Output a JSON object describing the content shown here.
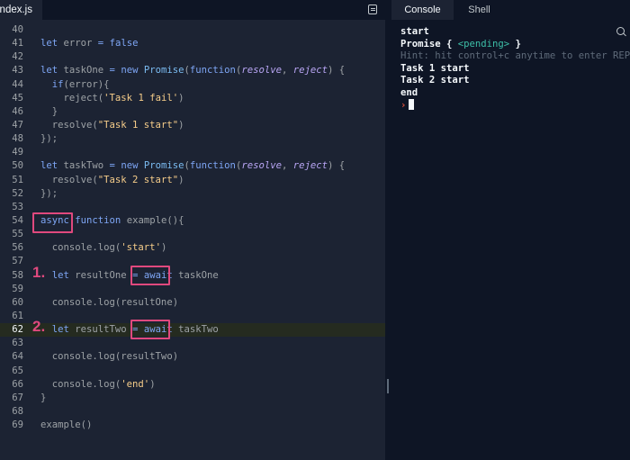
{
  "editor": {
    "file_tab": "index.js",
    "lines": [
      {
        "n": "40",
        "tokens": []
      },
      {
        "n": "41",
        "tokens": [
          [
            "k",
            "let"
          ],
          [
            "p",
            " error "
          ],
          [
            "k",
            "="
          ],
          [
            "p",
            " "
          ],
          [
            "k",
            "false"
          ]
        ]
      },
      {
        "n": "42",
        "tokens": []
      },
      {
        "n": "43",
        "tokens": [
          [
            "k",
            "let"
          ],
          [
            "p",
            " taskOne "
          ],
          [
            "k",
            "="
          ],
          [
            "p",
            " "
          ],
          [
            "k",
            "new"
          ],
          [
            "p",
            " "
          ],
          [
            "c",
            "Promise"
          ],
          [
            "p",
            "("
          ],
          [
            "k",
            "function"
          ],
          [
            "p",
            "("
          ],
          [
            "i",
            "resolve"
          ],
          [
            "p",
            ", "
          ],
          [
            "i",
            "reject"
          ],
          [
            "p",
            ") {"
          ]
        ]
      },
      {
        "n": "44",
        "tokens": [
          [
            "p",
            "  "
          ],
          [
            "k",
            "if"
          ],
          [
            "p",
            "(error){"
          ]
        ]
      },
      {
        "n": "45",
        "tokens": [
          [
            "p",
            "    reject("
          ],
          [
            "s",
            "'Task 1 fail'"
          ],
          [
            "p",
            ")"
          ]
        ]
      },
      {
        "n": "46",
        "tokens": [
          [
            "p",
            "  }"
          ]
        ]
      },
      {
        "n": "47",
        "tokens": [
          [
            "p",
            "  resolve("
          ],
          [
            "s",
            "\"Task 1 start\""
          ],
          [
            "p",
            ")"
          ]
        ]
      },
      {
        "n": "48",
        "tokens": [
          [
            "p",
            "});"
          ]
        ]
      },
      {
        "n": "49",
        "tokens": []
      },
      {
        "n": "50",
        "tokens": [
          [
            "k",
            "let"
          ],
          [
            "p",
            " taskTwo "
          ],
          [
            "k",
            "="
          ],
          [
            "p",
            " "
          ],
          [
            "k",
            "new"
          ],
          [
            "p",
            " "
          ],
          [
            "c",
            "Promise"
          ],
          [
            "p",
            "("
          ],
          [
            "k",
            "function"
          ],
          [
            "p",
            "("
          ],
          [
            "i",
            "resolve"
          ],
          [
            "p",
            ", "
          ],
          [
            "i",
            "reject"
          ],
          [
            "p",
            ") {"
          ]
        ]
      },
      {
        "n": "51",
        "tokens": [
          [
            "p",
            "  resolve("
          ],
          [
            "s",
            "\"Task 2 start\""
          ],
          [
            "p",
            ")"
          ]
        ]
      },
      {
        "n": "52",
        "tokens": [
          [
            "p",
            "});"
          ]
        ]
      },
      {
        "n": "53",
        "tokens": []
      },
      {
        "n": "54",
        "tokens": [
          [
            "k",
            "async"
          ],
          [
            "p",
            " "
          ],
          [
            "k",
            "function"
          ],
          [
            "p",
            " example(){"
          ]
        ]
      },
      {
        "n": "55",
        "tokens": []
      },
      {
        "n": "56",
        "tokens": [
          [
            "p",
            "  console.log("
          ],
          [
            "s",
            "'start'"
          ],
          [
            "p",
            ")"
          ]
        ]
      },
      {
        "n": "57",
        "tokens": []
      },
      {
        "n": "58",
        "tokens": [
          [
            "p",
            "  "
          ],
          [
            "k",
            "let"
          ],
          [
            "p",
            " resultOne "
          ],
          [
            "k",
            "="
          ],
          [
            "p",
            " "
          ],
          [
            "k",
            "await"
          ],
          [
            "p",
            " taskOne"
          ]
        ]
      },
      {
        "n": "59",
        "tokens": []
      },
      {
        "n": "60",
        "tokens": [
          [
            "p",
            "  console.log(resultOne)"
          ]
        ]
      },
      {
        "n": "61",
        "tokens": []
      },
      {
        "n": "62",
        "tokens": [
          [
            "p",
            "  "
          ],
          [
            "k",
            "let"
          ],
          [
            "p",
            " resultTwo "
          ],
          [
            "k",
            "="
          ],
          [
            "p",
            " "
          ],
          [
            "k",
            "await"
          ],
          [
            "p",
            " taskTwo"
          ]
        ],
        "active": true
      },
      {
        "n": "63",
        "tokens": []
      },
      {
        "n": "64",
        "tokens": [
          [
            "p",
            "  console.log(resultTwo)"
          ]
        ]
      },
      {
        "n": "65",
        "tokens": []
      },
      {
        "n": "66",
        "tokens": [
          [
            "p",
            "  console.log("
          ],
          [
            "s",
            "'end'"
          ],
          [
            "p",
            ")"
          ]
        ]
      },
      {
        "n": "67",
        "tokens": [
          [
            "p",
            "}"
          ]
        ]
      },
      {
        "n": "68",
        "tokens": []
      },
      {
        "n": "69",
        "tokens": [
          [
            "p",
            "example()"
          ]
        ]
      }
    ]
  },
  "annotations": {
    "label_1": "1.",
    "label_2": "2."
  },
  "console": {
    "tabs": [
      "Console",
      "Shell"
    ],
    "output": {
      "line1": "start",
      "promise_prefix": "Promise { ",
      "pending": "<pending>",
      "promise_suffix": " }",
      "hint": "Hint: hit control+c anytime to enter REPL.",
      "line4": "Task 1 start",
      "line5": "Task 2 start",
      "line6": "end",
      "prompt": "›"
    }
  },
  "colors": {
    "highlight_box": "#e0497e",
    "keyword": "#7ea6f5",
    "string": "#f6cd8a",
    "editor_bg": "#1c2333",
    "console_bg": "#0e1525"
  },
  "icons": {
    "editor_toolbar": "format-icon",
    "console_search": "search-icon"
  }
}
